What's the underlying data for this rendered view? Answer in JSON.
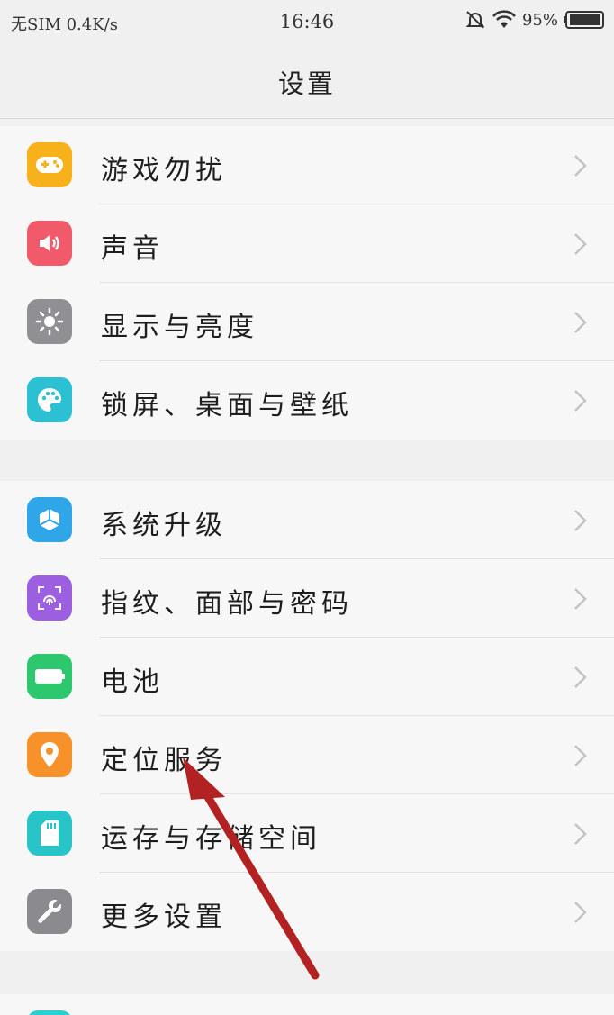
{
  "status_bar": {
    "carrier": "无SIM",
    "speed": "0.4K/s",
    "time": "16:46",
    "battery_percent": "95%"
  },
  "header": {
    "title": "设置"
  },
  "groups": [
    {
      "items": [
        {
          "label": "游戏勿扰",
          "icon": "gamepad-icon",
          "color": "#f7b21b"
        },
        {
          "label": "声音",
          "icon": "speaker-icon",
          "color": "#f05a6a"
        },
        {
          "label": "显示与亮度",
          "icon": "sun-icon",
          "color": "#8f8f94"
        },
        {
          "label": "锁屏、桌面与壁纸",
          "icon": "palette-icon",
          "color": "#2bc0d2"
        }
      ]
    },
    {
      "items": [
        {
          "label": "系统升级",
          "icon": "system-update-icon",
          "color": "#2fa6e8"
        },
        {
          "label": "指纹、面部与密码",
          "icon": "fingerprint-icon",
          "color": "#9b5fe0"
        },
        {
          "label": "电池",
          "icon": "battery-icon",
          "color": "#2dc76d"
        },
        {
          "label": "定位服务",
          "icon": "location-pin-icon",
          "color": "#f7912a"
        },
        {
          "label": "运存与存储空间",
          "icon": "sd-card-icon",
          "color": "#27c4c8"
        },
        {
          "label": "更多设置",
          "icon": "wrench-icon",
          "color": "#8a8a8f"
        }
      ]
    }
  ],
  "annotation": {
    "color": "#b22222"
  }
}
